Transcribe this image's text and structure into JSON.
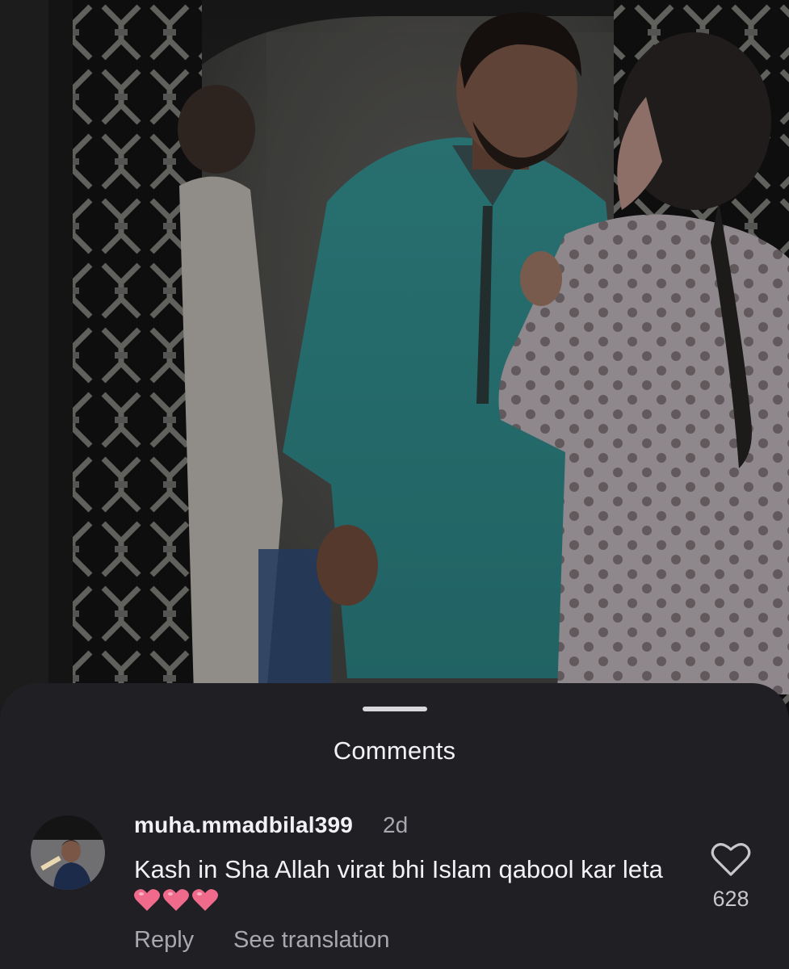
{
  "sheet": {
    "title": "Comments"
  },
  "comment": {
    "username": "muha.mmadbilal399",
    "time": "2d",
    "text": "Kash in Sha Allah virat bhi Islam qabool kar leta",
    "emoji_count": 3,
    "emoji": "pink-heart",
    "like_count": "628",
    "reply_label": "Reply",
    "translate_label": "See translation"
  },
  "colors": {
    "sheet_bg": "#1f1f24",
    "text_primary": "#f2f2f4",
    "text_secondary": "#a8a8ae",
    "heart_pink": "#f06a8c",
    "kurta_teal": "#2f8d8e"
  },
  "icons": [
    "heart-outline-icon",
    "pink-heart-icon"
  ]
}
